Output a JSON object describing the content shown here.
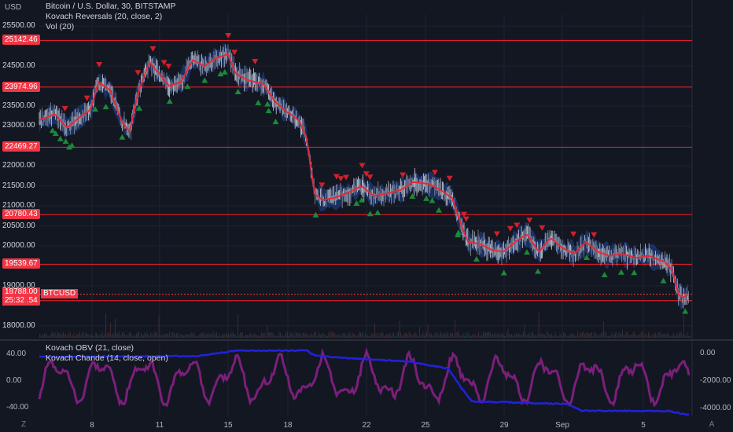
{
  "header": {
    "currency": "USD",
    "symbol_line": "Bitcoin / U.S. Dollar, 30, BITSTAMP",
    "indicator_1": "Kovach Reversals (20, close, 2)",
    "indicator_2": "Vol (20)"
  },
  "price_axis": {
    "ticks": [
      "25500.00",
      "24500.00",
      "23500.00",
      "23000.00",
      "22000.00",
      "21500.00",
      "21000.00",
      "20500.00",
      "20000.00",
      "19000.00",
      "18000.00"
    ],
    "tick_values": [
      25500,
      24500,
      23500,
      23000,
      22000,
      21500,
      21000,
      20500,
      20000,
      19000,
      18000
    ],
    "range": [
      17700,
      25800
    ]
  },
  "levels": [
    {
      "label": "25142.46",
      "value": 25142.46
    },
    {
      "label": "23974.96",
      "value": 23974.96
    },
    {
      "label": "22469.27",
      "value": 22469.27
    },
    {
      "label": "20780.43",
      "value": 20780.43
    },
    {
      "label": "19539.67",
      "value": 19539.67
    },
    {
      "label": "18629.54",
      "value": 18629.54
    }
  ],
  "last_price": {
    "value": "18788.00",
    "countdown": "25:32",
    "symbol": "BTCUSD",
    "price": 18788
  },
  "lower_pane": {
    "title_1": "Kovach OBV (21, close)",
    "title_2": "Kovach Chande (14, close, open)",
    "left_ticks": [
      "40.00",
      "0.00",
      "-40.00"
    ],
    "left_values": [
      40,
      0,
      -40
    ],
    "left_range": [
      -55,
      55
    ],
    "right_ticks": [
      "0.00",
      "-2000.00",
      "-4000.00"
    ],
    "right_values": [
      0,
      -2000,
      -4000
    ],
    "right_range": [
      -4700,
      700
    ],
    "colors": {
      "obv": "#2222dd",
      "chande": "#7b1f7b"
    }
  },
  "time_axis": {
    "labels": [
      "8",
      "11",
      "15",
      "18",
      "22",
      "25",
      "29",
      "Sep",
      "5"
    ]
  },
  "controls": {
    "z_label": "Z",
    "a_label": "A"
  },
  "colors": {
    "level": "#e01e2a",
    "ma": "#e22a38",
    "band": "#1e3a78",
    "up_marker": "#1a8a3a",
    "down_marker": "#d0202c"
  },
  "chart_data": [
    {
      "type": "line",
      "title": "Bitcoin / U.S. Dollar, 30, BITSTAMP",
      "x": [
        "8",
        "11",
        "15",
        "18",
        "22",
        "25",
        "29",
        "Sep",
        "5"
      ],
      "series": [
        {
          "name": "BTCUSD",
          "values": [
            23050,
            24700,
            24800,
            23100,
            21400,
            21600,
            20000,
            19800,
            18790
          ]
        }
      ],
      "ylabel": "USD",
      "ylim": [
        17700,
        25800
      ]
    },
    {
      "type": "line",
      "series": [
        {
          "name": "Kovach OBV (21, close)",
          "values": [
            -400,
            -300,
            0,
            -200,
            -900,
            -1300,
            -3700,
            -4100,
            -4400
          ]
        },
        {
          "name": "Kovach Chande (14, close, open)",
          "values": [
            25,
            10,
            15,
            -10,
            20,
            -5,
            -20,
            10,
            -40
          ]
        }
      ]
    }
  ]
}
